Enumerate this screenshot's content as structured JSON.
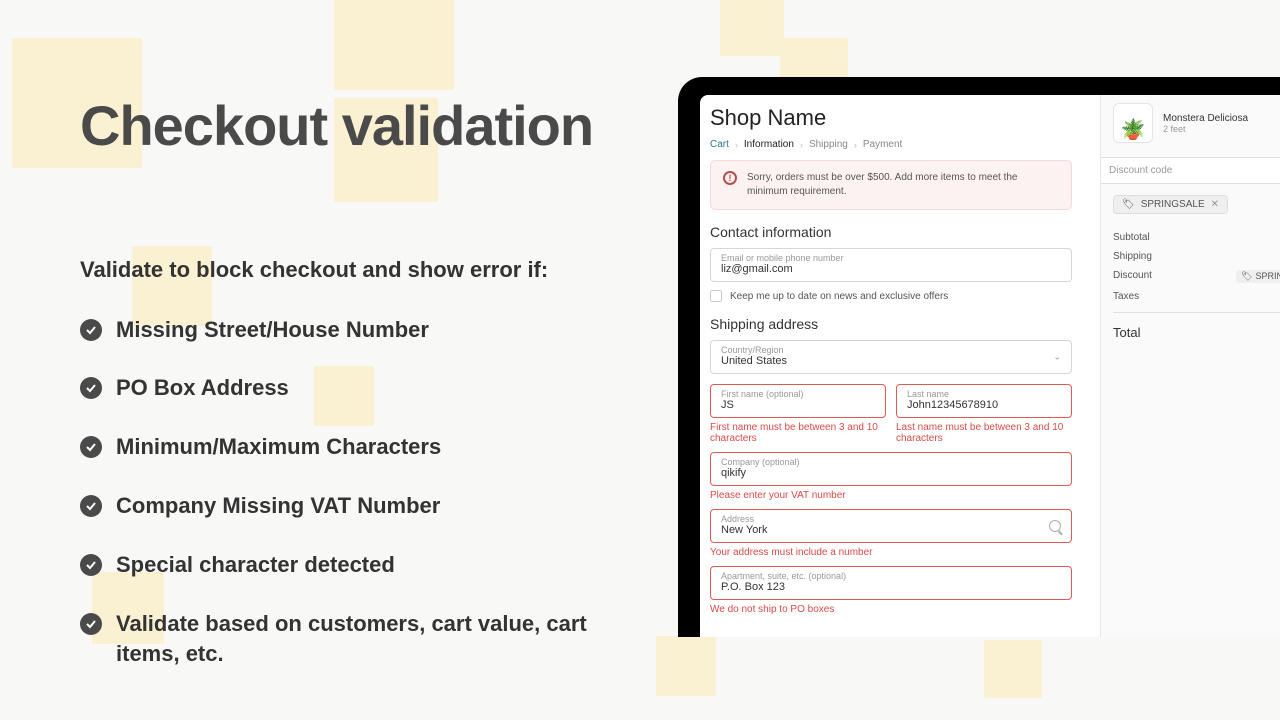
{
  "left": {
    "heading": "Checkout validation",
    "subheading": "Validate to block checkout and show error if:",
    "bullets": [
      "Missing Street/House Number",
      "PO Box Address",
      "Minimum/Maximum Characters",
      "Company Missing VAT Number",
      "Special character detected",
      "Validate based on customers, cart value, cart items, etc."
    ]
  },
  "checkout": {
    "shop_name": "Shop Name",
    "breadcrumb": {
      "cart": "Cart",
      "info": "Information",
      "shipping": "Shipping",
      "payment": "Payment"
    },
    "alert": "Sorry, orders must be over $500. Add more items to meet the minimum requirement.",
    "contact_heading": "Contact information",
    "email_label": "Email or mobile phone number",
    "email_value": "liz@gmail.com",
    "marketing_opt": "Keep me up to date on news and exclusive offers",
    "shipping_heading": "Shipping address",
    "country_label": "Country/Region",
    "country_value": "United States",
    "firstname_label": "First name (optional)",
    "firstname_value": "JS",
    "firstname_error": "First name must be between 3 and 10 characters",
    "lastname_label": "Last name",
    "lastname_value": "John12345678910",
    "lastname_error": "Last name must be between 3 and 10 characters",
    "company_label": "Company (optional)",
    "company_value": "qikify",
    "company_error": "Please enter your VAT number",
    "address_label": "Address",
    "address_value": "New York",
    "address_error": "Your address must include a number",
    "apt_label": "Apartment, suite, etc. (optional)",
    "apt_value": "P.O. Box 123",
    "apt_error": "We do not ship to PO boxes"
  },
  "cart": {
    "product_name": "Monstera Deliciosa",
    "product_variant": "2 feet",
    "discount_label": "Discount code",
    "discount_code": "SPRINGSALE",
    "lines": {
      "subtotal": "Subtotal",
      "shipping": "Shipping",
      "discount": "Discount",
      "taxes": "Taxes",
      "total": "Total"
    },
    "applied_code": "SPRINGSALE"
  }
}
